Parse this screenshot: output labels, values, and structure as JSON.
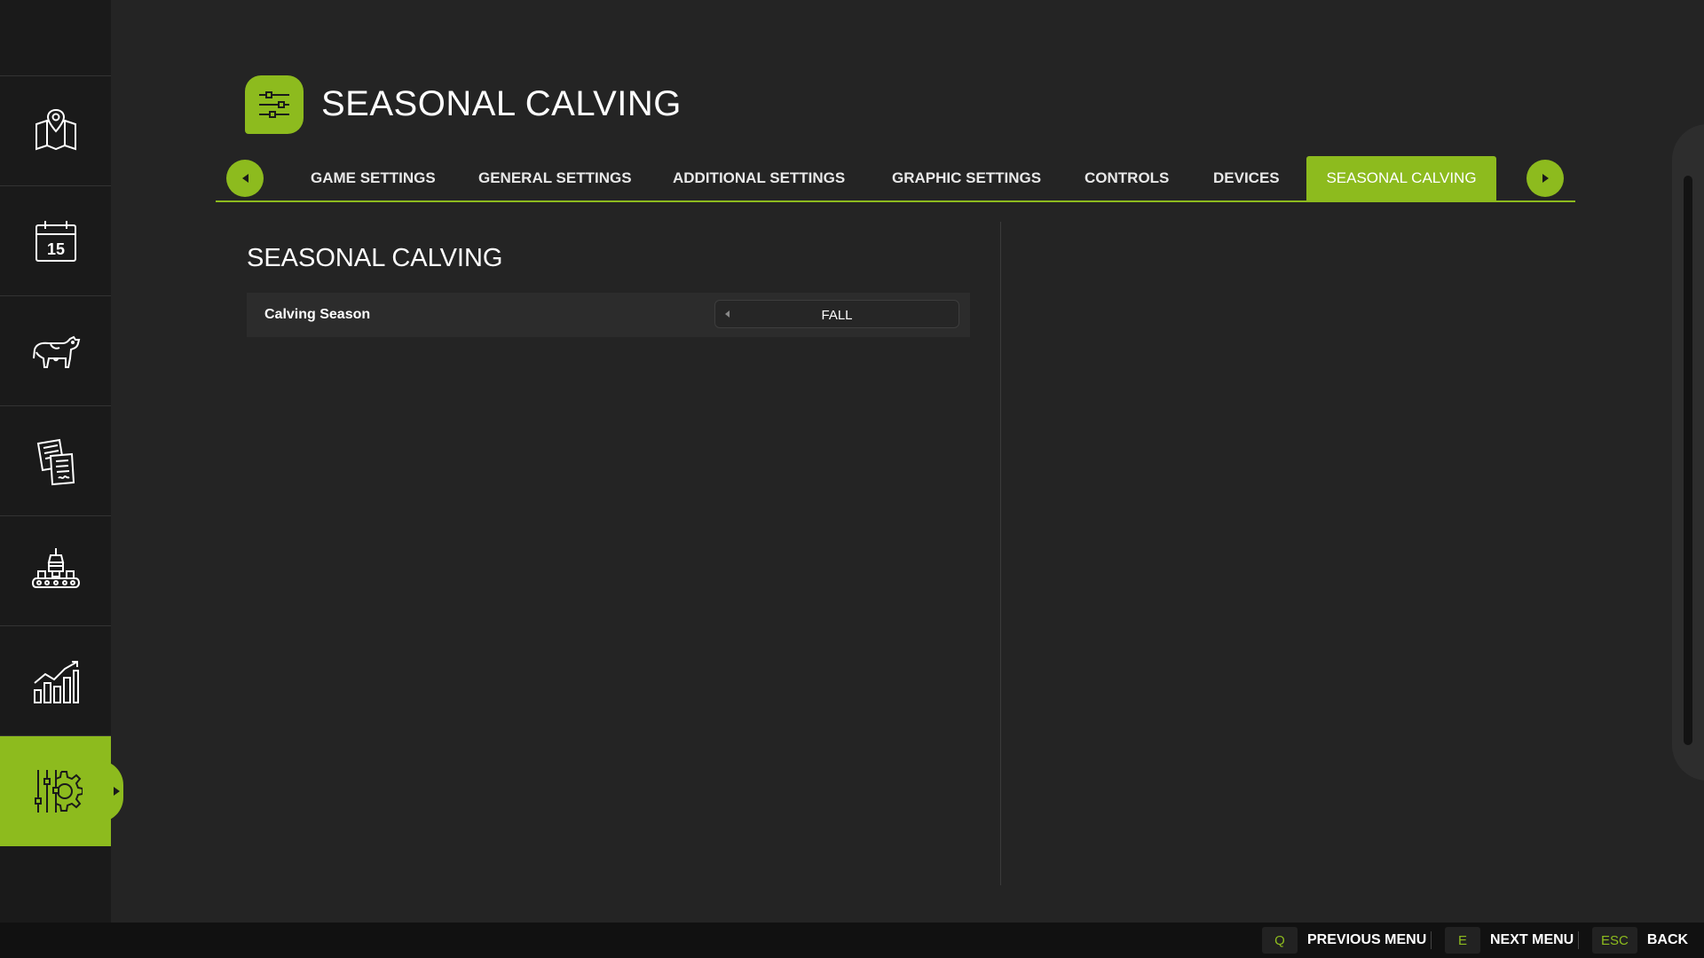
{
  "header": {
    "title": "SEASONAL CALVING",
    "icon": "sliders-icon"
  },
  "sidebar": {
    "items": [
      {
        "icon": "map-pin-icon",
        "active": false
      },
      {
        "icon": "calendar-icon",
        "date_number": "15",
        "active": false
      },
      {
        "icon": "cow-icon",
        "active": false
      },
      {
        "icon": "contracts-icon",
        "active": false
      },
      {
        "icon": "production-icon",
        "active": false
      },
      {
        "icon": "statistics-icon",
        "active": false
      },
      {
        "icon": "settings-icon",
        "active": true
      }
    ]
  },
  "tabs": [
    {
      "label": "GAME SETTINGS",
      "active": false
    },
    {
      "label": "GENERAL SETTINGS",
      "active": false
    },
    {
      "label": "ADDITIONAL SETTINGS",
      "active": false
    },
    {
      "label": "GRAPHIC SETTINGS",
      "active": false
    },
    {
      "label": "CONTROLS",
      "active": false
    },
    {
      "label": "DEVICES",
      "active": false
    },
    {
      "label": "SEASONAL CALVING",
      "active": true
    }
  ],
  "content": {
    "section_title": "SEASONAL CALVING",
    "settings": [
      {
        "label": "Calving Season",
        "value": "FALL"
      }
    ]
  },
  "footer": {
    "actions": [
      {
        "key": "Q",
        "label": "PREVIOUS MENU"
      },
      {
        "key": "E",
        "label": "NEXT MENU"
      },
      {
        "key": "ESC",
        "label": "BACK"
      }
    ]
  },
  "colors": {
    "accent": "#8dbb1e",
    "background": "#242424",
    "sidebar": "#1a1a1a",
    "footer": "#111111"
  }
}
